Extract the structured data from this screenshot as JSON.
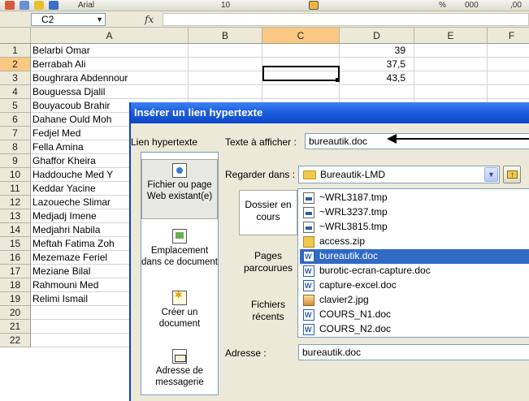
{
  "formula_bar": {
    "name_box": "C2",
    "fx": "fx"
  },
  "toolbar": {
    "font_name": "Arial",
    "font_size": "10",
    "percent": "%",
    "thousands": "000",
    "decimals": ",00"
  },
  "grid": {
    "columns": [
      "A",
      "B",
      "C",
      "D",
      "E",
      "F"
    ],
    "selected_column": "C",
    "selected_row": "2",
    "rows": [
      {
        "num": "1",
        "name": "Belarbi Omar",
        "score": "39"
      },
      {
        "num": "2",
        "name": "Berrabah Ali",
        "score": "37,5"
      },
      {
        "num": "3",
        "name": "Boughrara Abdennour",
        "score": "43,5"
      },
      {
        "num": "4",
        "name": "Bouguessa Djalil",
        "score": ""
      },
      {
        "num": "5",
        "name": "Bouyacoub Brahir",
        "score": ""
      },
      {
        "num": "6",
        "name": "Dahane Ould Moh",
        "score": ""
      },
      {
        "num": "7",
        "name": "Fedjel Med",
        "score": ""
      },
      {
        "num": "8",
        "name": "Fella Amina",
        "score": ""
      },
      {
        "num": "9",
        "name": "Ghaffor Kheira",
        "score": ""
      },
      {
        "num": "10",
        "name": "Haddouche Med Y",
        "score": ""
      },
      {
        "num": "11",
        "name": "Keddar Yacine",
        "score": ""
      },
      {
        "num": "12",
        "name": "Lazoueche Slimar",
        "score": ""
      },
      {
        "num": "13",
        "name": "Medjadj Imene",
        "score": ""
      },
      {
        "num": "14",
        "name": "Medjahri Nabila",
        "score": ""
      },
      {
        "num": "15",
        "name": "Meftah Fatima Zoh",
        "score": ""
      },
      {
        "num": "16",
        "name": "Mezemaze Feriel",
        "score": ""
      },
      {
        "num": "17",
        "name": "Meziane Bilal",
        "score": ""
      },
      {
        "num": "18",
        "name": "Rahmouni Med",
        "score": ""
      },
      {
        "num": "19",
        "name": "Relimi Ismail",
        "score": ""
      },
      {
        "num": "20",
        "name": "",
        "score": ""
      },
      {
        "num": "21",
        "name": "",
        "score": ""
      },
      {
        "num": "22",
        "name": "",
        "score": ""
      }
    ]
  },
  "dialog": {
    "title": "Insérer un lien hypertexte",
    "link_to_label": "Lien hypertexte",
    "places": [
      {
        "label": "Fichier ou page Web existant(e)",
        "icon": "web-page-icon"
      },
      {
        "label": "Emplacement dans ce document",
        "icon": "document-place-icon"
      },
      {
        "label": "Créer un document",
        "icon": "new-document-icon"
      },
      {
        "label": "Adresse de messagerie",
        "icon": "email-icon"
      }
    ],
    "text_to_display_label": "Texte à afficher :",
    "text_to_display_value": "bureautik.doc",
    "look_in_label": "Regarder dans :",
    "look_in_value": "Bureautik-LMD",
    "nav": [
      {
        "label": "Dossier en cours"
      },
      {
        "label": "Pages parcourues"
      },
      {
        "label": "Fichiers récents"
      }
    ],
    "files": [
      {
        "name": "~WRL3187.tmp",
        "type": "tmp"
      },
      {
        "name": "~WRL3237.tmp",
        "type": "tmp"
      },
      {
        "name": "~WRL3815.tmp",
        "type": "tmp"
      },
      {
        "name": "access.zip",
        "type": "zip"
      },
      {
        "name": "bureautik.doc",
        "type": "doc"
      },
      {
        "name": "burotic-ecran-capture.doc",
        "type": "doc"
      },
      {
        "name": "capture-excel.doc",
        "type": "doc"
      },
      {
        "name": "clavier2.jpg",
        "type": "jpg"
      },
      {
        "name": "COURS_N1.doc",
        "type": "doc"
      },
      {
        "name": "COURS_N2.doc",
        "type": "doc"
      }
    ],
    "selected_file": "bureautik.doc",
    "address_label": "Adresse :",
    "address_value": "bureautik.doc"
  }
}
